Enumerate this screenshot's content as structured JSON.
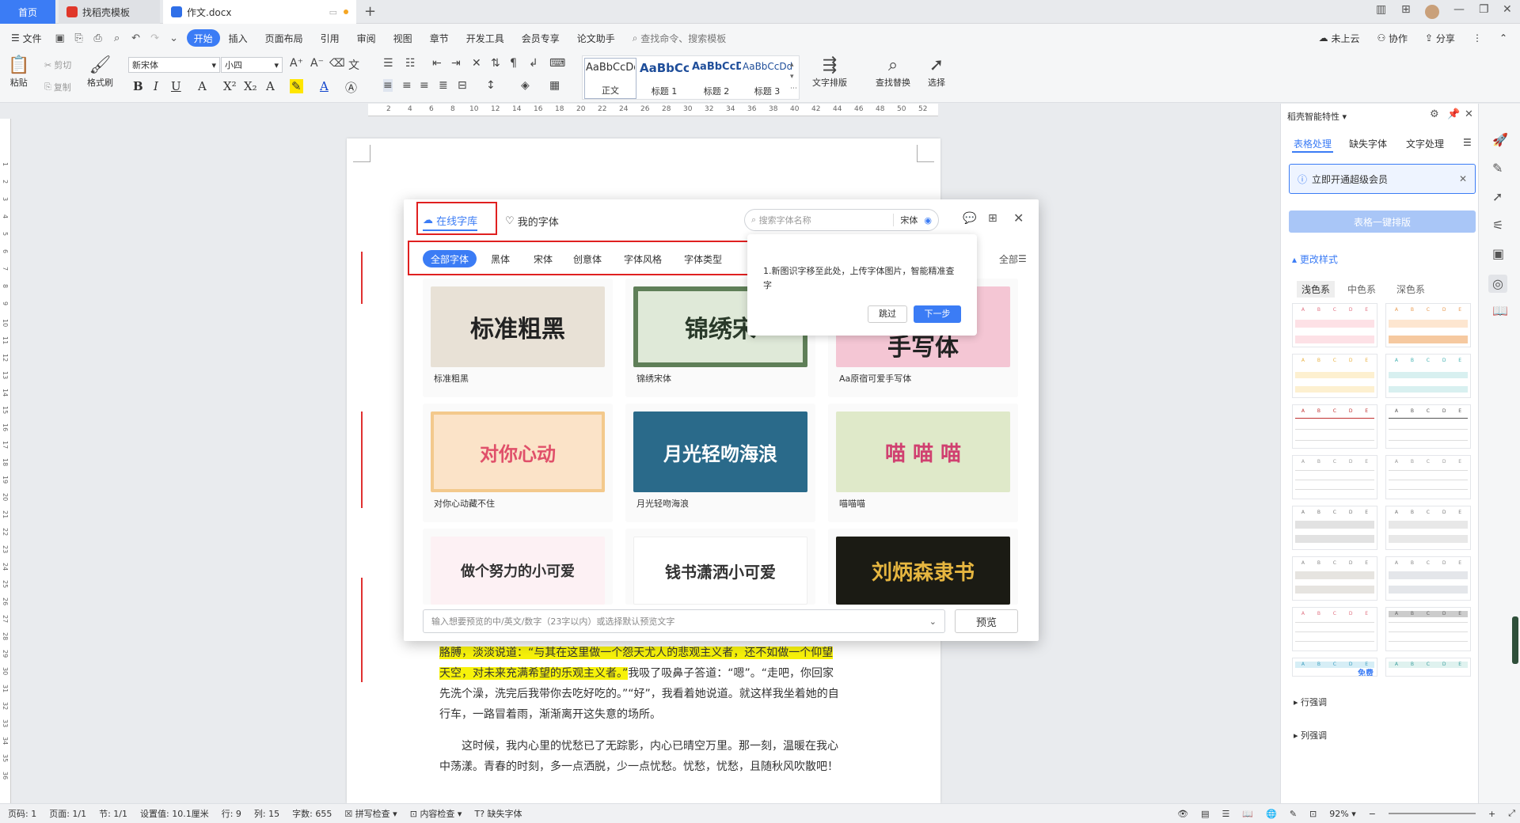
{
  "titlebar": {
    "tabs": [
      {
        "label": "首页"
      },
      {
        "label": "找稻壳模板"
      },
      {
        "label": "作文.docx"
      }
    ]
  },
  "menubar": {
    "file": "文件",
    "items": [
      "开始",
      "插入",
      "页面布局",
      "引用",
      "审阅",
      "视图",
      "章节",
      "开发工具",
      "会员专享",
      "论文助手"
    ],
    "search_placeholder": "查找命令、搜索模板",
    "right": [
      "未上云",
      "协作",
      "分享"
    ]
  },
  "ribbon": {
    "paste": "粘贴",
    "cut": "剪切",
    "copy": "复制",
    "format_painter": "格式刷",
    "font_name": "新宋体",
    "font_size": "小四",
    "styles": [
      {
        "sample": "AaBbCcDd",
        "name": "正文"
      },
      {
        "sample": "AaBbCc",
        "name": "标题 1"
      },
      {
        "sample": "AaBbCcD",
        "name": "标题 2"
      },
      {
        "sample": "AaBbCcDd",
        "name": "标题 3"
      }
    ],
    "text_layout": "文字排版",
    "find_replace": "查找替换",
    "select": "选择"
  },
  "ruler": {
    "marks": [
      "2",
      "4",
      "6",
      "8",
      "10",
      "12",
      "14",
      "16",
      "18",
      "20",
      "22",
      "24",
      "26",
      "28",
      "30",
      "32",
      "34",
      "36",
      "38",
      "40",
      "42",
      "44",
      "46",
      "48",
      "50",
      "52"
    ],
    "vmarks": [
      "1",
      "2",
      "3",
      "4",
      "5",
      "6",
      "7",
      "8",
      "9",
      "10",
      "11",
      "12",
      "13",
      "14",
      "15",
      "16",
      "17",
      "18",
      "19",
      "20",
      "21",
      "22",
      "23",
      "24",
      "25",
      "26",
      "27",
      "28",
      "29",
      "30",
      "31",
      "32",
      "33",
      "34",
      "35",
      "36"
    ]
  },
  "dialog": {
    "tab_online": "在线字库",
    "tab_mine": "我的字体",
    "search_placeholder": "搜索字体名称",
    "search_font": "宋体",
    "categories": [
      "全部字体",
      "黑体",
      "宋体",
      "创意体",
      "字体风格",
      "字体类型"
    ],
    "all_label": "全部",
    "tooltip_text": "1.新图识字移至此处，上传字体图片，智能精准查字",
    "skip": "跳过",
    "next": "下一步",
    "fonts": [
      {
        "art": "标准粗黑",
        "caption": "标准粗黑"
      },
      {
        "art": "锦绣宋",
        "caption": "锦绣宋体"
      },
      {
        "art": "手写体",
        "caption": "Aa原宿可爱手写体"
      },
      {
        "art": "对你心动",
        "caption": "对你心动藏不住"
      },
      {
        "art": "月光轻吻海浪",
        "caption": "月光轻吻海浪"
      },
      {
        "art": "喵 喵 喵",
        "caption": "喵喵喵"
      },
      {
        "art": "做个努力的小可爱",
        "caption": ""
      },
      {
        "art": "钱书潇洒小可爱",
        "caption": ""
      },
      {
        "art": "刘炳森隶书",
        "caption": ""
      }
    ],
    "preview_placeholder": "输入想要预览的中/英文/数字（23字以内）或选择默认预览文字",
    "preview_button": "预览"
  },
  "document": {
    "p1_hl": "胳膊，淡淡说道：“与其在这里做一个怨天尤人的悲观主义者，还不如做一个仰望天空，对未来充满希望的乐观主义者。”",
    "p1_rest": "我吸了吸鼻子答道：“嗯”。“走吧，你回家先洗个澡，洗完后我带你去吃好吃的。”“好”，我看着她说道。就这样我坐着她的自行车，一路冒着雨，渐渐离开这失意的场所。",
    "p2": "这时候，我内心里的忧愁已了无踪影，内心已晴空万里。那一刻，温暖在我心中荡漾。青春的时刻，多一点洒脱，少一点忧愁。忧愁，忧愁，且随秋风吹散吧！"
  },
  "panel": {
    "title": "稻壳智能特性",
    "tabs": [
      "表格处理",
      "缺失字体",
      "文字处理"
    ],
    "notice": "立即开通超级会员",
    "one_click": "表格一键排版",
    "section": "更改样式",
    "color_tabs": [
      "浅色系",
      "中色系",
      "深色系"
    ],
    "free_badge": "免费",
    "row_emph": "行强调",
    "col_emph": "列强调",
    "thumb_letters": [
      "A",
      "B",
      "C",
      "D",
      "E"
    ],
    "accent": "#3b7cf5"
  },
  "statusbar": {
    "page_num": "页码: 1",
    "pages": "页面: 1/1",
    "section": "节: 1/1",
    "setting": "设置值: 10.1厘米",
    "row": "行: 9",
    "col": "列: 15",
    "words": "字数: 655",
    "spell": "拼写检查",
    "content_check": "内容检查",
    "missing_font": "缺失字体",
    "zoom": "92%"
  }
}
